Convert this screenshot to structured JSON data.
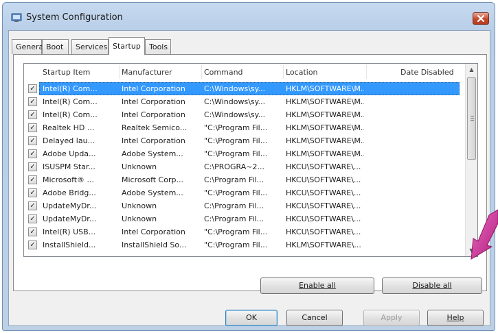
{
  "window": {
    "title": "System Configuration"
  },
  "tabs": [
    {
      "label": "General"
    },
    {
      "label": "Boot"
    },
    {
      "label": "Services"
    },
    {
      "label": "Startup",
      "active": true
    },
    {
      "label": "Tools"
    }
  ],
  "list": {
    "columns": [
      "Startup Item",
      "Manufacturer",
      "Command",
      "Location",
      "Date Disabled"
    ],
    "rows": [
      {
        "checked": true,
        "item": "Intel(R) Com...",
        "manufacturer": "Intel Corporation",
        "command": "C:\\Windows\\sy...",
        "location": "HKLM\\SOFTWARE\\M...",
        "date_disabled": "",
        "selected": true
      },
      {
        "checked": true,
        "item": "Intel(R) Com...",
        "manufacturer": "Intel Corporation",
        "command": "C:\\Windows\\sy...",
        "location": "HKLM\\SOFTWARE\\M...",
        "date_disabled": ""
      },
      {
        "checked": true,
        "item": "Intel(R) Com...",
        "manufacturer": "Intel Corporation",
        "command": "C:\\Windows\\sy...",
        "location": "HKLM\\SOFTWARE\\M...",
        "date_disabled": ""
      },
      {
        "checked": true,
        "item": "Realtek HD ...",
        "manufacturer": "Realtek Semico...",
        "command": "\"C:\\Program Fil...",
        "location": "HKLM\\SOFTWARE\\M...",
        "date_disabled": ""
      },
      {
        "checked": true,
        "item": "Delayed lau...",
        "manufacturer": "Intel Corporation",
        "command": "\"C:\\Program Fil...",
        "location": "HKLM\\SOFTWARE\\M...",
        "date_disabled": ""
      },
      {
        "checked": true,
        "item": "Adobe Upda...",
        "manufacturer": "Adobe System...",
        "command": "\"C:\\Program Fil...",
        "location": "HKLM\\SOFTWARE\\M...",
        "date_disabled": ""
      },
      {
        "checked": true,
        "item": "ISUSPM Star...",
        "manufacturer": "Unknown",
        "command": "C:\\PROGRA~2...",
        "location": "HKCU\\SOFTWARE\\...",
        "date_disabled": ""
      },
      {
        "checked": true,
        "item": "Microsoft® ...",
        "manufacturer": "Microsoft Corp...",
        "command": "C:\\Program Fil...",
        "location": "HKCU\\SOFTWARE\\...",
        "date_disabled": ""
      },
      {
        "checked": true,
        "item": "Adobe Bridg...",
        "manufacturer": "Adobe System...",
        "command": "\"C:\\Program Fil...",
        "location": "HKCU\\SOFTWARE\\...",
        "date_disabled": ""
      },
      {
        "checked": true,
        "item": "UpdateMyDr...",
        "manufacturer": "Unknown",
        "command": "C:\\Program Fil...",
        "location": "HKCU\\SOFTWARE\\...",
        "date_disabled": ""
      },
      {
        "checked": true,
        "item": "UpdateMyDr...",
        "manufacturer": "Unknown",
        "command": "C:\\Program Fil...",
        "location": "HKCU\\SOFTWARE\\...",
        "date_disabled": ""
      },
      {
        "checked": true,
        "item": "Intel(R) USB...",
        "manufacturer": "Intel Corporation",
        "command": "\"C:\\Program Fil...",
        "location": "HKCU\\SOFTWARE\\...",
        "date_disabled": ""
      },
      {
        "checked": true,
        "item": "InstallShield...",
        "manufacturer": "InstallShield So...",
        "command": "\"C:\\Program Fil...",
        "location": "HKLM\\SOFTWARE\\...",
        "date_disabled": ""
      }
    ]
  },
  "panel_buttons": {
    "enable_all": "Enable all",
    "disable_all": "Disable all"
  },
  "dialog_buttons": {
    "ok": "OK",
    "cancel": "Cancel",
    "apply": "Apply",
    "help": "Help"
  },
  "colors": {
    "selection": "#3399ff",
    "titlebar": "#bcd0e6",
    "close_button": "#c6482b",
    "arrow": "#d0359a"
  },
  "icons": {
    "app": "system-config-icon",
    "close": "close-icon",
    "check": "check-icon",
    "arrow": "pointer-arrow-icon"
  }
}
